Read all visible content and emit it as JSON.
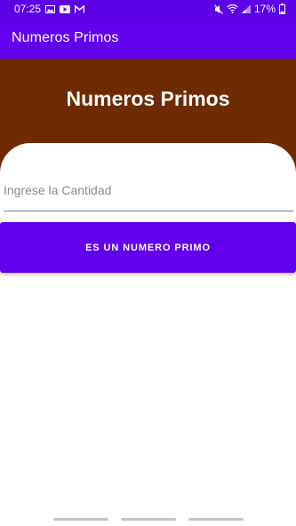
{
  "status_bar": {
    "time": "07:25",
    "battery_percent": "17%",
    "left_icons": [
      "image-icon",
      "youtube-icon",
      "gmail-icon"
    ],
    "right_icons": [
      "mute-icon",
      "wifi-icon",
      "signal-icon",
      "battery-icon"
    ]
  },
  "app_bar": {
    "title": "Numeros Primos"
  },
  "header": {
    "title": "Numeros Primos",
    "background_color": "#6e2a00"
  },
  "form": {
    "input_placeholder": "Ingrese la Cantidad",
    "input_value": "",
    "button_label": "ES UN NUMERO PRIMO"
  },
  "colors": {
    "primary": "#6200ee",
    "status_bar": "#5c00e6",
    "header": "#6e2a00"
  }
}
